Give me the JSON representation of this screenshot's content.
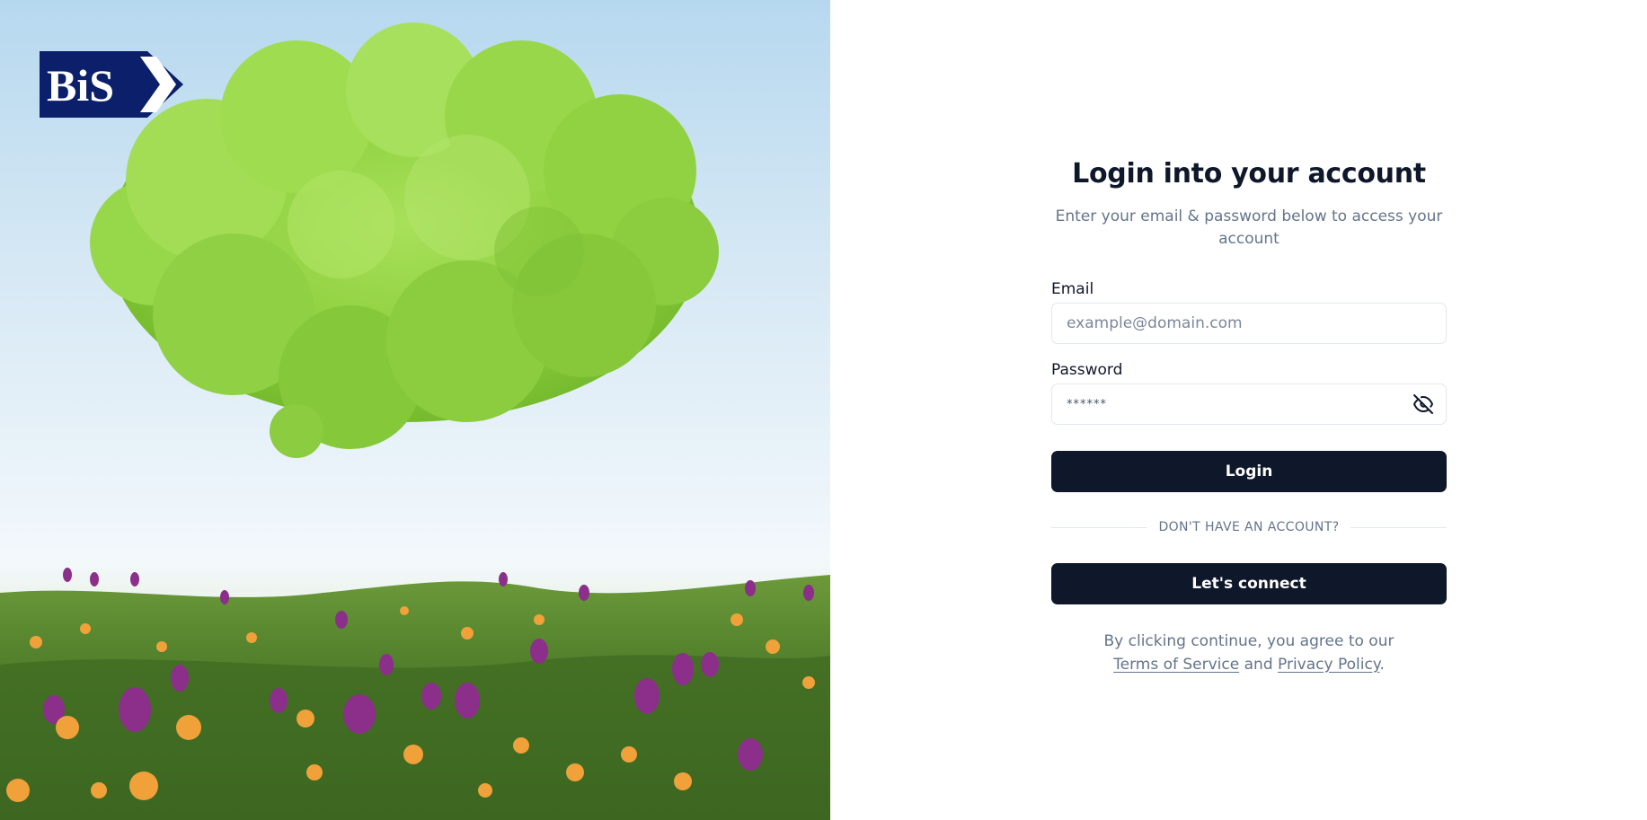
{
  "brand": {
    "logo_text": "BiS",
    "colors": {
      "navy": "#0b1f6b",
      "white": "#ffffff"
    }
  },
  "hero": {
    "icon": "green-cloud-meadow-illustration"
  },
  "login": {
    "title": "Login into your account",
    "subtitle": "Enter your email & password below to access your account",
    "email": {
      "label": "Email",
      "placeholder": "example@domain.com",
      "value": ""
    },
    "password": {
      "label": "Password",
      "value": "******",
      "toggle_icon": "eye-off-icon"
    },
    "login_button": "Login",
    "divider_text": "DON'T HAVE AN ACCOUNT?",
    "connect_button": "Let's connect",
    "legal": {
      "prefix": "By clicking continue, you agree to our",
      "terms": "Terms of Service",
      "and": "and",
      "privacy": "Privacy Policy",
      "suffix": "."
    }
  },
  "theme": {
    "primary": "#0f172a",
    "muted_text": "#64748b",
    "border": "#e2e8f0"
  }
}
